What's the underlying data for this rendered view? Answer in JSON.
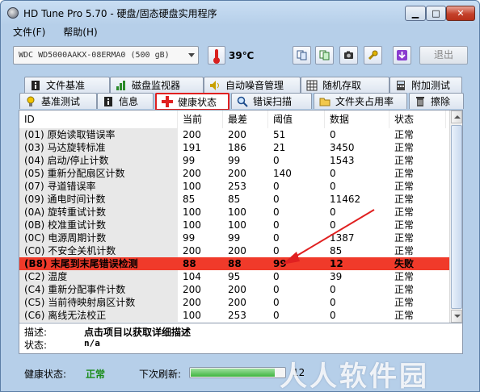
{
  "window": {
    "title": "HD Tune Pro 5.70 - 硬盘/固态硬盘实用程序"
  },
  "menu": [
    "文件(F)",
    "帮助(H)"
  ],
  "toolbar": {
    "drive": "WDC WD5000AAKX-08ERMA0 (500 gB)",
    "temperature": "39℃",
    "exit_label": "退出"
  },
  "tabs_top": [
    "文件基准",
    "磁盘监视器",
    "自动噪音管理",
    "随机存取",
    "附加测试"
  ],
  "tabs_bottom": [
    "基准测试",
    "信息",
    "健康状态",
    "错误扫描",
    "文件夹占用率",
    "擦除"
  ],
  "table": {
    "headers": {
      "id": "ID",
      "current": "当前",
      "worst": "最差",
      "threshold": "阈值",
      "data": "数据",
      "status": "状态"
    },
    "rows": [
      [
        "(01) 原始读取错误率",
        "200",
        "200",
        "51",
        "0",
        "正常"
      ],
      [
        "(03) 马达旋转标准",
        "191",
        "186",
        "21",
        "3450",
        "正常"
      ],
      [
        "(04) 启动/停止计数",
        "99",
        "99",
        "0",
        "1543",
        "正常"
      ],
      [
        "(05) 重新分配扇区计数",
        "200",
        "200",
        "140",
        "0",
        "正常"
      ],
      [
        "(07) 寻道错误率",
        "100",
        "253",
        "0",
        "0",
        "正常"
      ],
      [
        "(09) 通电时间计数",
        "85",
        "85",
        "0",
        "11462",
        "正常"
      ],
      [
        "(0A) 旋转重试计数",
        "100",
        "100",
        "0",
        "0",
        "正常"
      ],
      [
        "(0B) 校准重试计数",
        "100",
        "100",
        "0",
        "0",
        "正常"
      ],
      [
        "(0C) 电源周期计数",
        "99",
        "99",
        "0",
        "1387",
        "正常"
      ],
      [
        "(C0) 不安全关机计数",
        "200",
        "200",
        "0",
        "85",
        "正常"
      ],
      [
        "(B8) 末尾到末尾错误检测",
        "88",
        "88",
        "99",
        "12",
        "失败"
      ],
      [
        "(C2) 温度",
        "104",
        "95",
        "0",
        "39",
        "正常"
      ],
      [
        "(C4) 重新分配事件计数",
        "200",
        "200",
        "0",
        "0",
        "正常"
      ],
      [
        "(C5) 当前待映射扇区计数",
        "200",
        "200",
        "0",
        "0",
        "正常"
      ],
      [
        "(C6) 离线无法校正",
        "100",
        "253",
        "0",
        "0",
        "正常"
      ]
    ]
  },
  "description": {
    "label1": "描述:",
    "value1": "点击项目以获取详细描述",
    "label2": "状态:",
    "value2": "n/a"
  },
  "status": {
    "health_label": "健康状态:",
    "health_value": "正常",
    "refresh_label": "下次刷新:",
    "refresh_value": "12",
    "refresh_progress": 0.9
  },
  "watermark": "人人软件园",
  "colors": {
    "alert_row": "#f03a2a",
    "healthy": "#1a8c1a",
    "active_tab_border": "#e02020"
  }
}
